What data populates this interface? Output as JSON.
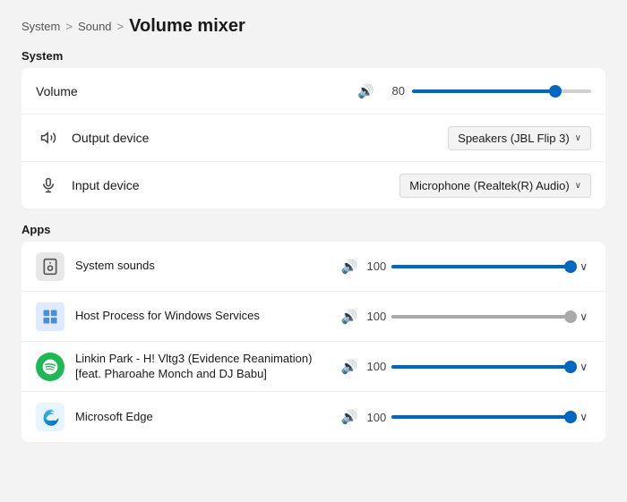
{
  "breadcrumb": {
    "system": "System",
    "sep1": ">",
    "sound": "Sound",
    "sep2": ">",
    "page": "Volume mixer"
  },
  "system_section": {
    "label": "System",
    "volume_row": {
      "label": "Volume",
      "value": 80,
      "fill_pct": 80
    },
    "output_row": {
      "label": "Output device",
      "dropdown": "Speakers (JBL Flip 3)"
    },
    "input_row": {
      "label": "Input device",
      "dropdown": "Microphone (Realtek(R) Audio)"
    }
  },
  "apps_section": {
    "label": "Apps",
    "apps": [
      {
        "name": "System sounds",
        "volume": 100,
        "fill_pct": 100,
        "thumb_color": "blue",
        "icon_type": "system"
      },
      {
        "name": "Host Process for Windows Services",
        "volume": 100,
        "fill_pct": 100,
        "thumb_color": "gray",
        "icon_type": "host"
      },
      {
        "name": "Linkin Park - H! Vltg3 (Evidence Reanimation)\n[feat. Pharoahe Monch and DJ Babu]",
        "name_line1": "Linkin Park - H! Vltg3 (Evidence Reanimation)",
        "name_line2": "[feat. Pharoahe Monch and DJ Babu]",
        "volume": 100,
        "fill_pct": 100,
        "thumb_color": "blue",
        "icon_type": "spotify"
      },
      {
        "name": "Microsoft Edge",
        "volume": 100,
        "fill_pct": 100,
        "thumb_color": "blue",
        "icon_type": "edge"
      }
    ]
  },
  "icons": {
    "speaker": "🔊",
    "chevron_down": "∨",
    "output_device": "🔊",
    "input_device": "🎤"
  }
}
